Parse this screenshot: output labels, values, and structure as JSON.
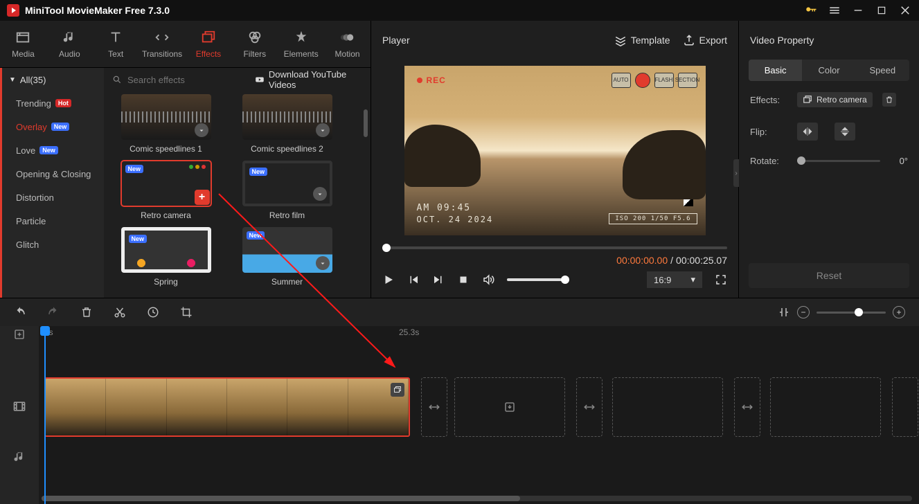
{
  "title": "MiniTool MovieMaker Free 7.3.0",
  "toolbar": [
    "Media",
    "Audio",
    "Text",
    "Transitions",
    "Effects",
    "Filters",
    "Elements",
    "Motion"
  ],
  "toolbar_active": 4,
  "categories_head": "All(35)",
  "categories": [
    {
      "label": "Trending",
      "badge": "Hot",
      "badge_cls": "badge-hot"
    },
    {
      "label": "Overlay",
      "badge": "New",
      "badge_cls": "badge-new",
      "active": true
    },
    {
      "label": "Love",
      "badge": "New",
      "badge_cls": "badge-new"
    },
    {
      "label": "Opening & Closing"
    },
    {
      "label": "Distortion"
    },
    {
      "label": "Particle"
    },
    {
      "label": "Glitch"
    }
  ],
  "search_placeholder": "Search effects",
  "download_link": "Download YouTube Videos",
  "cards": [
    {
      "label": "Comic speedlines 1",
      "cls": "thumb-speed1",
      "dl": true
    },
    {
      "label": "Comic speedlines 2",
      "cls": "thumb-speed1",
      "dl": true
    },
    {
      "label": "Retro camera",
      "cls": "thumb-retro",
      "new": true,
      "selected": true,
      "add": true
    },
    {
      "label": "Retro film",
      "cls": "thumb-retrofilm",
      "new": true,
      "dl": true
    },
    {
      "label": "Spring",
      "cls": "thumb-spring",
      "new": true
    },
    {
      "label": "Summer",
      "cls": "thumb-summer",
      "new": true,
      "dl": true
    }
  ],
  "player": {
    "title": "Player",
    "template": "Template",
    "export": "Export",
    "rec": "REC",
    "cam_btns": [
      "AUTO",
      "",
      "FLASH",
      "SECTION"
    ],
    "overlay_time": "AM  09:45",
    "overlay_date": "OCT. 24 2024",
    "overlay_info": "ISO 200  1/50  F5.6",
    "cur": "00:00:00.00",
    "tot": "00:00:25.07",
    "sep": " / ",
    "aspect": "16:9"
  },
  "props": {
    "title": "Video Property",
    "tabs": [
      "Basic",
      "Color",
      "Speed"
    ],
    "tab_active": 0,
    "effects_label": "Effects:",
    "effect_name": "Retro camera",
    "flip_label": "Flip:",
    "rotate_label": "Rotate:",
    "rotate_val": "0°",
    "reset": "Reset"
  },
  "timeline": {
    "r0": "0s",
    "r1": "25.3s"
  }
}
